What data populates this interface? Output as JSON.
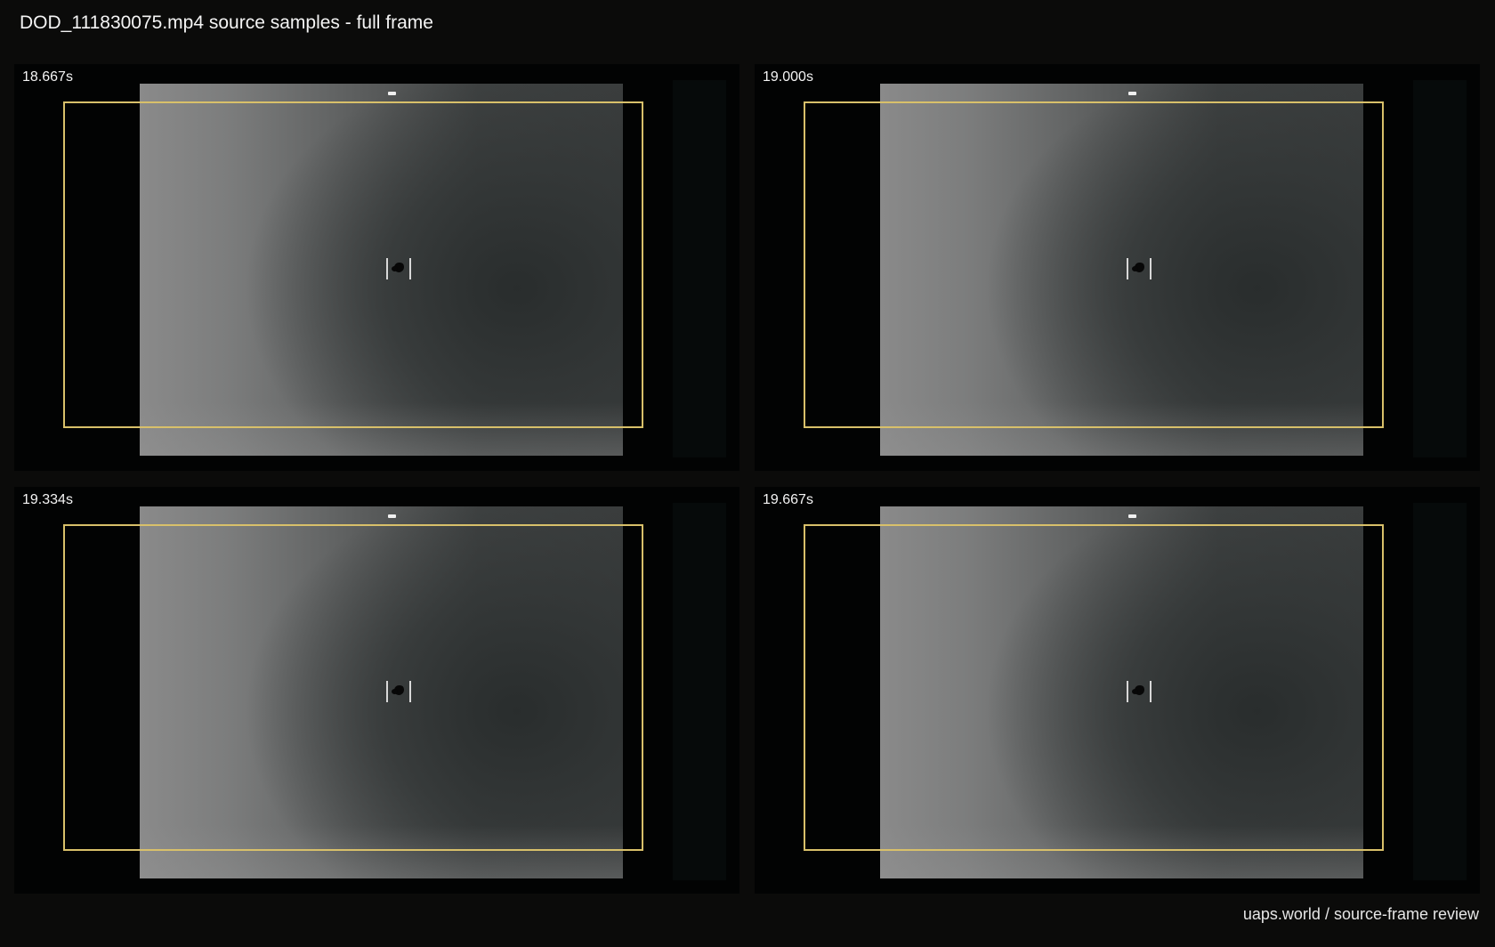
{
  "header": {
    "title": "DOD_111830075.mp4 source samples - full frame"
  },
  "panels": [
    {
      "timestamp": "18.667s"
    },
    {
      "timestamp": "19.000s"
    },
    {
      "timestamp": "19.334s"
    },
    {
      "timestamp": "19.667s"
    }
  ],
  "footer": {
    "credit": "uaps.world / source-frame review"
  },
  "colors": {
    "background": "#0b0b0a",
    "crop_box": "#d8c06a",
    "text": "#f2f2f2"
  }
}
